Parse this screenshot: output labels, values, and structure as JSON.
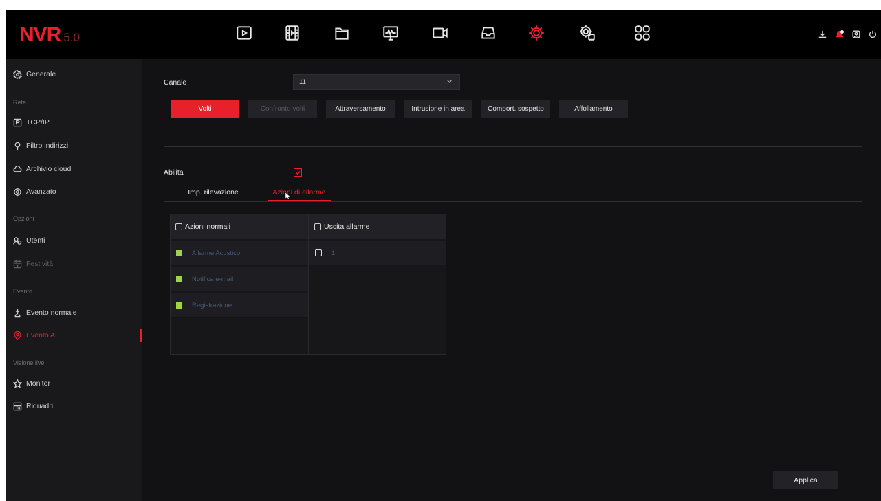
{
  "app": {
    "logo": "NVR",
    "version": "5.0"
  },
  "topbar": {
    "icons": [
      "playback-icon",
      "video-clips-icon",
      "files-icon",
      "system-monitor-icon",
      "camera-icon",
      "storage-icon",
      "settings-icon",
      "advanced-settings-icon",
      "apps-grid-icon"
    ],
    "active_icon": "settings-icon",
    "right_icons": [
      "download-icon",
      "alarm-bell-icon",
      "user-icon",
      "power-icon"
    ]
  },
  "sidebar": {
    "items": [
      {
        "label": "Generale",
        "icon": "gear-circle-icon"
      },
      {
        "group": "Rete"
      },
      {
        "label": "TCP/IP",
        "icon": "p-box-icon"
      },
      {
        "label": "Filtro indirizzi",
        "icon": "filter-icon"
      },
      {
        "label": "Archivio cloud",
        "icon": "cloud-icon"
      },
      {
        "label": "Avanzato",
        "icon": "gear-advanced-icon"
      },
      {
        "group": "Opzioni"
      },
      {
        "label": "Utenti",
        "icon": "users-icon"
      },
      {
        "label": "Festività",
        "icon": "calendar-icon",
        "dim": true
      },
      {
        "group": "Evento"
      },
      {
        "label": "Evento normale",
        "icon": "event-icon"
      },
      {
        "label": "Evento AI",
        "icon": "ai-location-icon",
        "active": true
      },
      {
        "group": "Visione live"
      },
      {
        "label": "Monitor",
        "icon": "star-icon"
      },
      {
        "label": "Riquadri",
        "icon": "layout-icon"
      }
    ]
  },
  "main": {
    "channel_label": "Canale",
    "channel_value": "11",
    "event_tabs": [
      {
        "label": "Volti",
        "state": "active"
      },
      {
        "label": "Confronto volti",
        "state": "disabled"
      },
      {
        "label": "Attraversamento",
        "state": "normal"
      },
      {
        "label": "Intrusione in area",
        "state": "normal"
      },
      {
        "label": "Comport. sospetto",
        "state": "normal"
      },
      {
        "label": "Affollamento",
        "state": "normal"
      }
    ],
    "enable_label": "Abilita",
    "enable_checked": true,
    "sub_tabs": [
      {
        "label": "Imp. rilevazione",
        "active": false
      },
      {
        "label": "Azioni di allarme",
        "active": true
      }
    ],
    "normal_actions": {
      "header": "Azioni normali",
      "items": [
        "Allarme Acustico",
        "Notifica e-mail",
        "Registrazione"
      ]
    },
    "alarm_output": {
      "header": "Uscita allarme",
      "items": [
        "1"
      ]
    },
    "apply_label": "Applica"
  },
  "colors": {
    "accent": "#e8202a",
    "background": "#121214",
    "sidebar": "#19191c",
    "enabled_indicator": "#9fd34b"
  }
}
